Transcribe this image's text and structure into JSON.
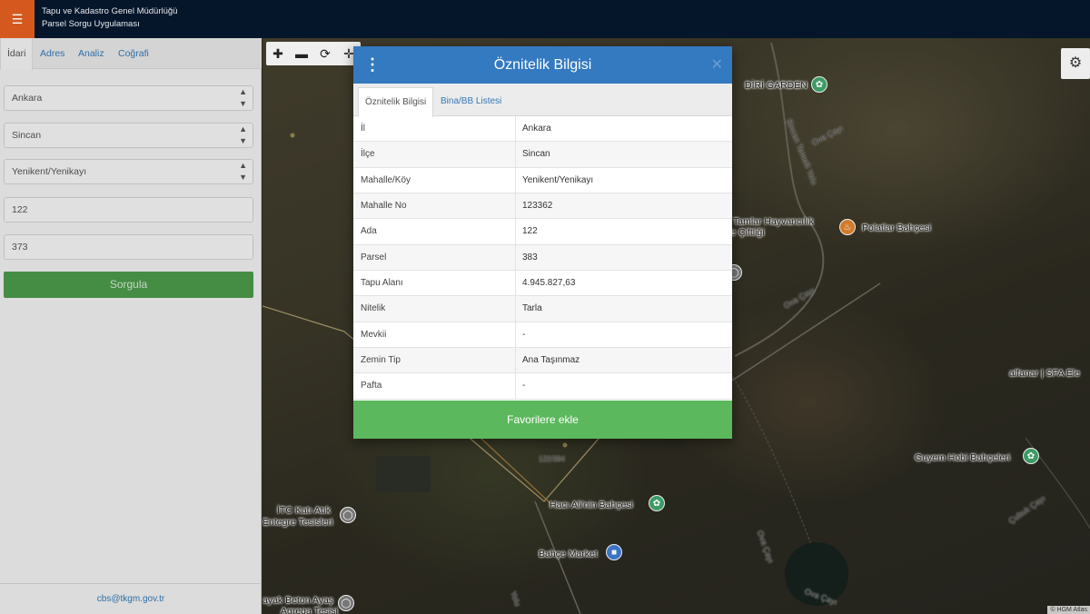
{
  "header": {
    "menu_icon": "hamburger-icon",
    "org_name": "Tapu ve Kadastro Genel Müdürlüğü",
    "app_name": "Parsel Sorgu Uygulaması"
  },
  "sidebar": {
    "tabs": [
      {
        "label": "İdari",
        "active": true
      },
      {
        "label": "Adres",
        "active": false
      },
      {
        "label": "Analiz",
        "active": false
      },
      {
        "label": "Coğrafi",
        "active": false
      }
    ],
    "il_select": "Ankara",
    "ilce_select": "Sincan",
    "mahalle_select": "Yenikent/Yenikayı",
    "ada_input": "122",
    "parsel_input": "373",
    "query_button": "Sorgula",
    "footer_email": "cbs@tkgm.gov.tr"
  },
  "map": {
    "labels": {
      "diri_garden": "DİRİ GARDEN",
      "sincan_temelli": "Sincan Temelli Yolu",
      "ova_cayi_1": "Ova Çayı",
      "ova_cayi_2": "Ova Çayı",
      "ova_cayi_3": "Ova Çayı",
      "ova_cayi_4": "Ova Çayı",
      "tamlar": "Tamlar Hayvancılık",
      "ciftligi": "ve Çiftliği",
      "polatlar": "Polatlar Bahçesi",
      "alfanar": "alfanar | SFA Ele",
      "guyem": "Guyem Hobi Bahçeleri",
      "cubuk_cayi": "Çubuk Çayı",
      "itc": "İTC Katı Atık",
      "entegre": "Entegre Tesisleri",
      "haci_ali": "Hacı Ali'nin Bahçesi",
      "bahce_market": "Bahçe Market",
      "ayak_beton": "ayak Beton Ayaş",
      "agrega": "Agrega Tesisi",
      "yolu": "Yolu",
      "parcel_label": "122/384"
    },
    "attribution": "© HGM Atlas"
  },
  "modal": {
    "title": "Öznitelik Bilgisi",
    "tabs": [
      {
        "label": "Öznitelik Bilgisi",
        "active": true
      },
      {
        "label": "Bina/BB Listesi",
        "active": false
      }
    ],
    "rows": [
      {
        "key": "İl",
        "value": "Ankara"
      },
      {
        "key": "İlçe",
        "value": "Sincan"
      },
      {
        "key": "Mahalle/Köy",
        "value": "Yenikent/Yenikayı"
      },
      {
        "key": "Mahalle No",
        "value": "123362"
      },
      {
        "key": "Ada",
        "value": "122"
      },
      {
        "key": "Parsel",
        "value": "383"
      },
      {
        "key": "Tapu Alanı",
        "value": "4.945.827,63"
      },
      {
        "key": "Nitelik",
        "value": "Tarla"
      },
      {
        "key": "Mevkii",
        "value": "-"
      },
      {
        "key": "Zemin Tip",
        "value": "Ana Taşınmaz"
      },
      {
        "key": "Pafta",
        "value": "-"
      }
    ],
    "favorite_button": "Favorilere ekle"
  },
  "colors": {
    "header_bg": "#05162b",
    "menu_accent": "#d5591e",
    "modal_header": "#337ac0",
    "primary_green": "#5cb85c",
    "link_blue": "#337ab7"
  }
}
